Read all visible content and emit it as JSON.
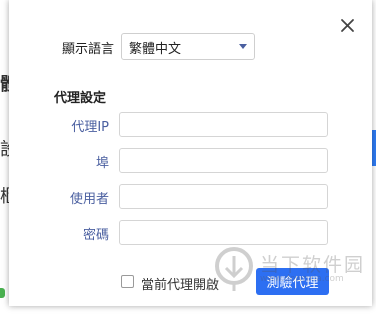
{
  "dialog": {
    "language_label": "顯示語言",
    "language_value": "繁體中文",
    "proxy_section_title": "代理設定",
    "fields": {
      "ip_label": "代理IP",
      "port_label": "埠",
      "user_label": "使用者",
      "password_label": "密碼",
      "ip_value": "",
      "port_value": "",
      "user_value": "",
      "password_value": ""
    },
    "enable_proxy_label": "當前代理開啟",
    "enable_proxy_checked": false,
    "test_button_label": "測驗代理"
  },
  "background": {
    "frag1": "體",
    "frag2": "設",
    "frag3": "櫃"
  },
  "watermark": {
    "text": "当下软件园",
    "sub": "www.downxia.com"
  },
  "colors": {
    "accent": "#2d6ff2",
    "label_blue": "#4a5fa0"
  },
  "icons": {
    "close": "close-icon",
    "dropdown": "chevron-down-icon",
    "watermark": "watermark-logo-icon"
  }
}
